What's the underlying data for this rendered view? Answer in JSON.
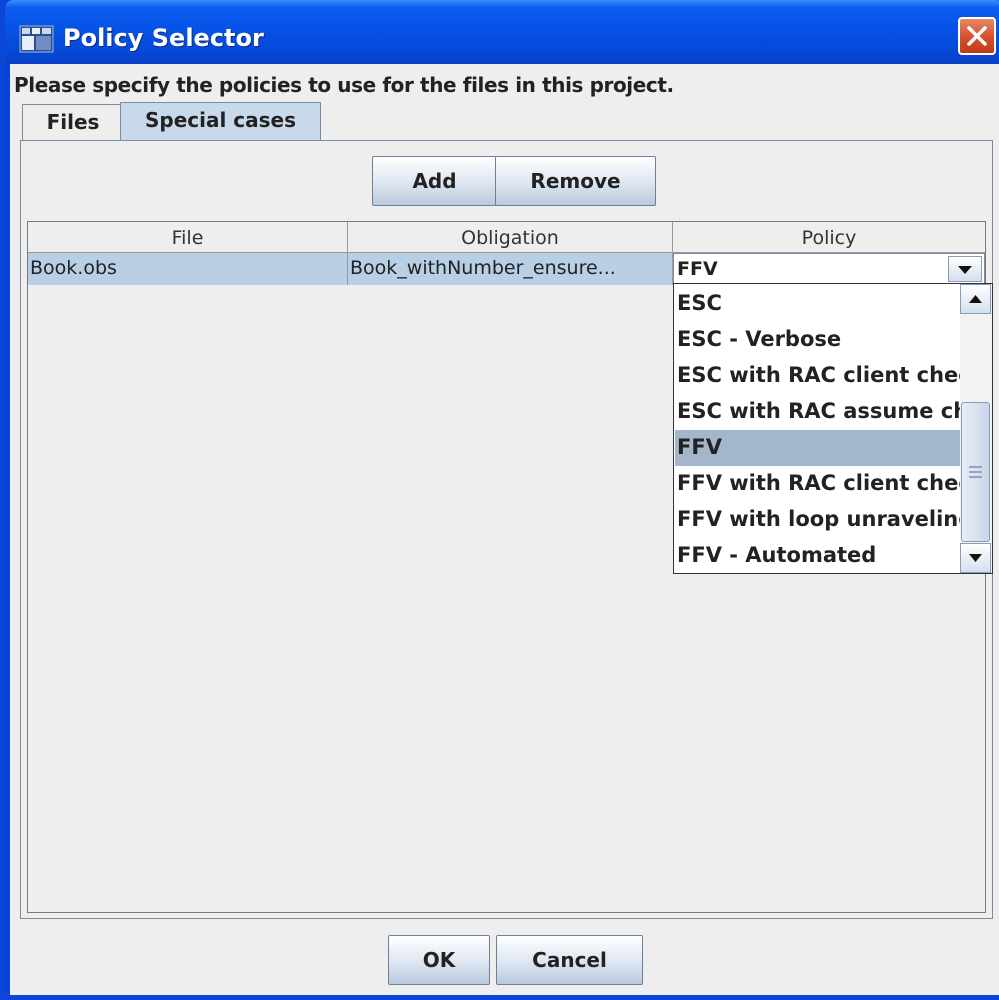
{
  "window": {
    "title": "Policy Selector",
    "close_label": "×"
  },
  "instruction": "Please specify the policies to use for the files in this project.",
  "tabs": [
    {
      "label": "Files",
      "active": false
    },
    {
      "label": "Special cases",
      "active": true
    }
  ],
  "toolbar": {
    "add_label": "Add",
    "remove_label": "Remove"
  },
  "table": {
    "columns": [
      "File",
      "Obligation",
      "Policy"
    ],
    "rows": [
      {
        "file": "Book.obs",
        "obligation": "Book_withNumber_ensure...",
        "policy": "FFV"
      }
    ]
  },
  "policy_dropdown": {
    "options": [
      "ESC",
      "ESC - Verbose",
      "ESC with RAC client chec",
      "ESC with RAC assume ch",
      "FFV",
      "FFV with RAC client check",
      "FFV with loop unraveling",
      "FFV - Automated"
    ],
    "selected": "FFV"
  },
  "footer": {
    "ok_label": "OK",
    "cancel_label": "Cancel"
  },
  "colors": {
    "title_bar": "#0653e6",
    "selection": "#a3b6cc",
    "row_selection": "#b8cfe5",
    "close_button": "#d6532e"
  }
}
